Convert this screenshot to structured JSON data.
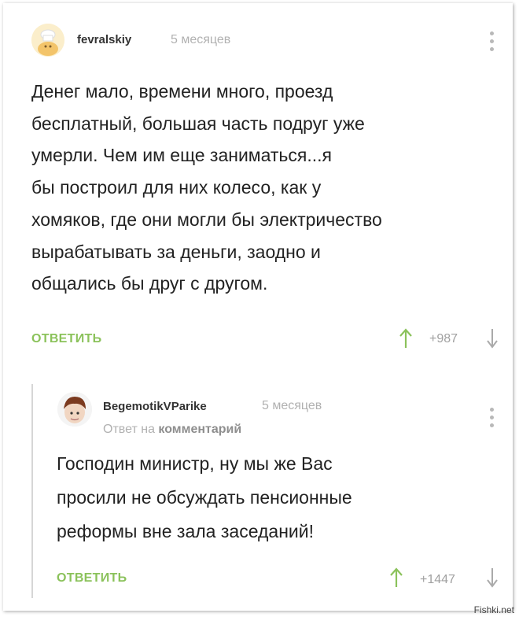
{
  "comments": [
    {
      "username": "fevralskiy",
      "time": "5 месяцев",
      "lines": [
        "Денег мало, времени много, проезд",
        "бесплатный, большая часть подруг уже",
        "умерли. Чем им еще заниматься...я",
        "бы построил для них колесо, как у",
        "хомяков, где они могли бы электричество",
        "вырабатывать за деньги, заодно и",
        "общались бы друг с другом."
      ],
      "reply_label": "ОТВЕТИТЬ",
      "score": "+987"
    },
    {
      "username": "BegemotikVParike",
      "time": "5 месяцев",
      "reply_to_prefix": "Ответ на",
      "reply_to_target": "комментарий",
      "lines": [
        "Господин министр, ну мы же Вас",
        "просили не обсуждать пенсионные",
        "реформы вне зала заседаний!"
      ],
      "reply_label": "ОТВЕТИТЬ",
      "score": "+1447"
    }
  ],
  "watermark": "Fishki.net",
  "colors": {
    "accent": "#8bc25b",
    "muted": "#b1b1b1",
    "text": "#222222"
  }
}
